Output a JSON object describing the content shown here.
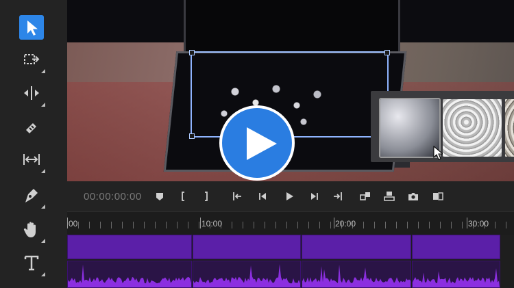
{
  "tools": [
    {
      "id": "selection",
      "icon": "arrow-pointer-icon",
      "active": true
    },
    {
      "id": "track-select",
      "icon": "track-select-forward-icon",
      "active": false
    },
    {
      "id": "ripple-edit",
      "icon": "ripple-edit-icon",
      "active": false
    },
    {
      "id": "razor",
      "icon": "razor-icon",
      "active": false
    },
    {
      "id": "slip",
      "icon": "slip-icon",
      "active": false
    },
    {
      "id": "pen",
      "icon": "pen-icon",
      "active": false
    },
    {
      "id": "hand",
      "icon": "hand-icon",
      "active": false
    },
    {
      "id": "type",
      "icon": "type-icon",
      "active": false
    }
  ],
  "colors": {
    "accent": "#2d86e8",
    "play_button": "#2a7de1",
    "video_clip": "#5b1fa8",
    "audio_wave": "#8b2fe0"
  },
  "transport": {
    "timecode": "00:00:00:00",
    "buttons": [
      "add-marker-icon",
      "mark-in-icon",
      "mark-out-icon",
      "go-to-in-icon",
      "step-back-icon",
      "play-icon",
      "step-forward-icon",
      "go-to-out-icon",
      "insert-icon",
      "overwrite-icon",
      "export-frame-icon",
      "comparison-view-icon"
    ]
  },
  "ruler": {
    "labels": [
      "00",
      "10:00",
      "20:00",
      "30:00"
    ]
  },
  "overlay": {
    "play_icon": "play-circle-icon",
    "thumbnails": [
      "diamonds-closeup-thumbnail",
      "diamonds-pile-thumbnail",
      "diamonds-warm-thumbnail"
    ]
  }
}
